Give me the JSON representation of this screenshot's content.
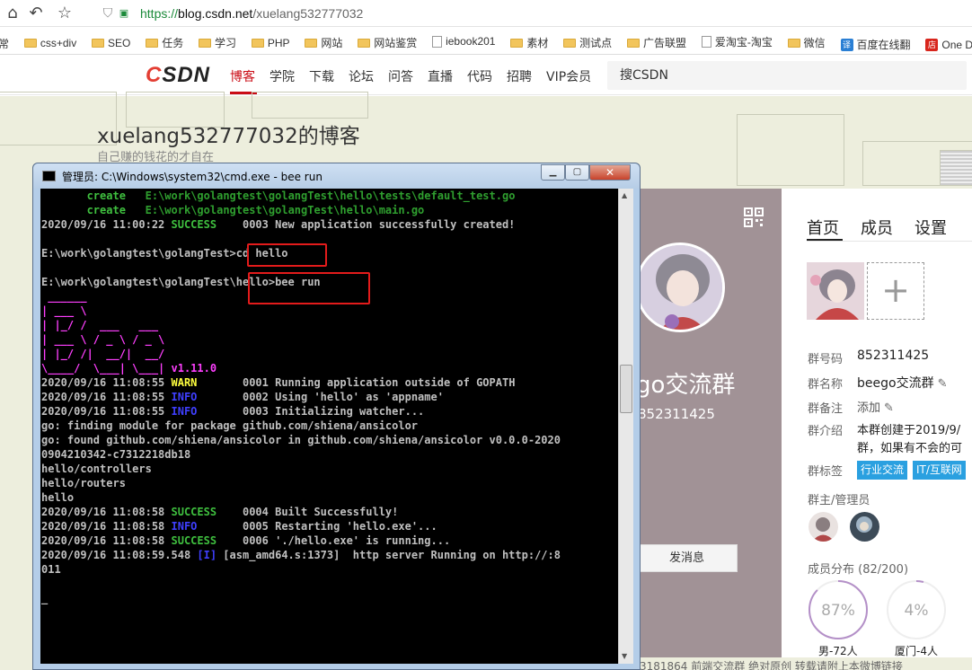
{
  "browser": {
    "url_scheme": "https://",
    "url_host": "blog.csdn.net",
    "url_path": "/xuelang532777032",
    "bookmarks": [
      "常",
      "css+div",
      "SEO",
      "任务",
      "学习",
      "PHP",
      "网站",
      "网站鉴赏",
      "iebook201",
      "素材",
      "测试点",
      "广告联盟",
      "爱淘宝-淘宝",
      "微信",
      "百度在线翻",
      "One Day 特"
    ]
  },
  "csdn": {
    "logo": "CSDN",
    "nav": [
      "博客",
      "学院",
      "下载",
      "论坛",
      "问答",
      "直播",
      "代码",
      "招聘",
      "VIP会员"
    ],
    "search_placeholder": "搜CSDN"
  },
  "blog": {
    "title": "xuelang532777032的博客",
    "subtitle": "自己赚的钱花的才自在"
  },
  "group": {
    "name_big": "go交流群",
    "id_big": "852311425",
    "send_msg": "发消息",
    "tabs": [
      "首页",
      "成员",
      "设置"
    ],
    "fields": [
      {
        "label": "群号码",
        "value": "852311425"
      },
      {
        "label": "群名称",
        "value": "beego交流群"
      },
      {
        "label": "群备注",
        "value": "添加"
      },
      {
        "label": "群介绍",
        "value": "本群创建于2019/9/",
        "value2": "群，如果有不会的可"
      },
      {
        "label": "群标签",
        "value": ""
      }
    ],
    "tags": [
      "行业交流",
      "IT/互联网"
    ],
    "admin_label": "群主/管理员",
    "dist_label": "成员分布 (82/200)",
    "dist": [
      {
        "pct": "87%",
        "label": "男-72人",
        "value": 0.87
      },
      {
        "pct": "4%",
        "label": "厦门-4人",
        "value": 0.04
      }
    ],
    "footer": "3181864  前端交流群    绝对原创    转载请附上本微博链接"
  },
  "cmd": {
    "title": "管理员: C:\\Windows\\system32\\cmd.exe - bee  run",
    "lines": [
      {
        "p": [
          {
            "t": "       "
          },
          {
            "t": "create",
            "c": "g"
          },
          {
            "t": "   "
          },
          {
            "t": "E:\\work\\golangtest\\golangTest\\hello\\tests\\default_test.go",
            "c": "dg"
          }
        ]
      },
      {
        "p": [
          {
            "t": "       "
          },
          {
            "t": "create",
            "c": "g"
          },
          {
            "t": "   "
          },
          {
            "t": "E:\\work\\golangtest\\golangTest\\hello\\main.go",
            "c": "dg"
          }
        ]
      },
      {
        "p": [
          {
            "t": "2020/09/16 11:00:22 "
          },
          {
            "t": "SUCCESS",
            "c": "g"
          },
          {
            "t": "    0003 New application successfully created!"
          }
        ]
      },
      {
        "p": [
          {
            "t": ""
          }
        ]
      },
      {
        "p": [
          {
            "t": "E:\\work\\golangtest\\golangTest>cd hello"
          }
        ]
      },
      {
        "p": [
          {
            "t": ""
          }
        ]
      },
      {
        "p": [
          {
            "t": "E:\\work\\golangtest\\golangTest\\hello>bee run"
          }
        ]
      },
      {
        "p": [
          {
            "t": " ______",
            "c": "m"
          }
        ]
      },
      {
        "p": [
          {
            "t": "| ___ \\",
            "c": "m"
          }
        ]
      },
      {
        "p": [
          {
            "t": "| |_/ /  ___   ___",
            "c": "m"
          }
        ]
      },
      {
        "p": [
          {
            "t": "| ___ \\ / _ \\ / _ \\",
            "c": "m"
          }
        ]
      },
      {
        "p": [
          {
            "t": "| |_/ /|  __/|  __/",
            "c": "m"
          }
        ]
      },
      {
        "p": [
          {
            "t": "\\____/  \\___| \\___| ",
            "c": "m"
          },
          {
            "t": "v1.11.0",
            "c": "m"
          }
        ]
      },
      {
        "p": [
          {
            "t": "2020/09/16 11:08:55 "
          },
          {
            "t": "WARN",
            "c": "y"
          },
          {
            "t": "       0001 Running application outside of GOPATH"
          }
        ]
      },
      {
        "p": [
          {
            "t": "2020/09/16 11:08:55 "
          },
          {
            "t": "INFO",
            "c": "b"
          },
          {
            "t": "       0002 Using 'hello' as 'appname'"
          }
        ]
      },
      {
        "p": [
          {
            "t": "2020/09/16 11:08:55 "
          },
          {
            "t": "INFO",
            "c": "b"
          },
          {
            "t": "       0003 Initializing watcher..."
          }
        ]
      },
      {
        "p": [
          {
            "t": "go: finding module for package github.com/shiena/ansicolor"
          }
        ]
      },
      {
        "p": [
          {
            "t": "go: found github.com/shiena/ansicolor in github.com/shiena/ansicolor v0.0.0-2020"
          }
        ]
      },
      {
        "p": [
          {
            "t": "0904210342-c7312218db18"
          }
        ]
      },
      {
        "p": [
          {
            "t": "hello/controllers"
          }
        ]
      },
      {
        "p": [
          {
            "t": "hello/routers"
          }
        ]
      },
      {
        "p": [
          {
            "t": "hello"
          }
        ]
      },
      {
        "p": [
          {
            "t": "2020/09/16 11:08:58 "
          },
          {
            "t": "SUCCESS",
            "c": "g"
          },
          {
            "t": "    0004 Built Successfully!"
          }
        ]
      },
      {
        "p": [
          {
            "t": "2020/09/16 11:08:58 "
          },
          {
            "t": "INFO",
            "c": "b"
          },
          {
            "t": "       0005 Restarting 'hello.exe'..."
          }
        ]
      },
      {
        "p": [
          {
            "t": "2020/09/16 11:08:58 "
          },
          {
            "t": "SUCCESS",
            "c": "g"
          },
          {
            "t": "    0006 './hello.exe' is running..."
          }
        ]
      },
      {
        "p": [
          {
            "t": "2020/09/16 11:08:59.548 "
          },
          {
            "t": "[I]",
            "c": "b"
          },
          {
            "t": " [asm_amd64.s:1373]  http server Running on http://:8"
          }
        ]
      },
      {
        "p": [
          {
            "t": "011"
          }
        ]
      },
      {
        "p": [
          {
            "t": ""
          }
        ]
      },
      {
        "p": [
          {
            "t": "_"
          }
        ]
      }
    ]
  },
  "colors": {
    "csdn_red": "#ca0c16",
    "cmd_bg": "#000000",
    "highlight_box": "#e31b1b",
    "tag_blue": "#2aa0e0"
  }
}
